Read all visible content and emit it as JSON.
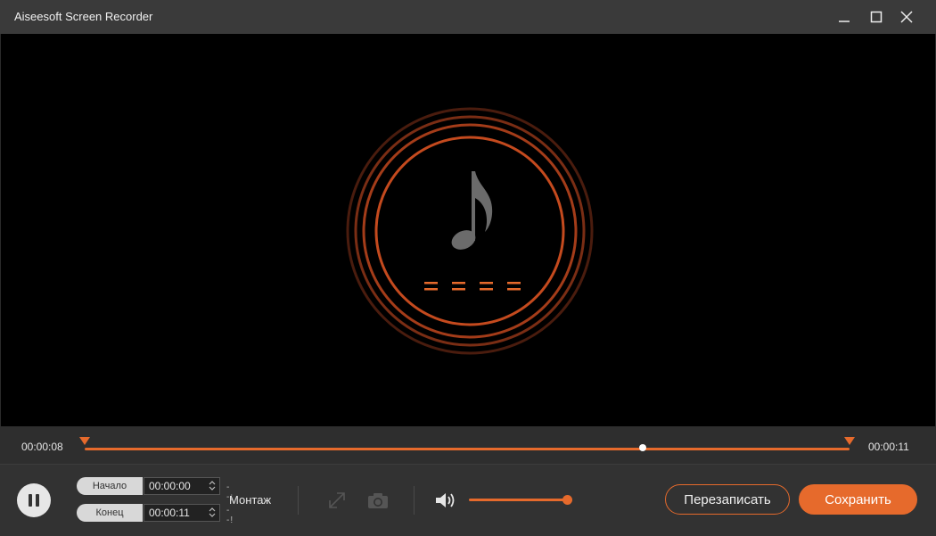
{
  "window": {
    "title": "Aiseesoft Screen Recorder"
  },
  "colors": {
    "accent": "#e66a2c",
    "background": "#2b2b2b",
    "preview": "#000000"
  },
  "preview": {
    "icon": "music-note-icon",
    "equalizer": "= = = ="
  },
  "timeline": {
    "current_time": "00:00:08",
    "total_time": "00:00:11",
    "progress_fraction": 0.73
  },
  "trim": {
    "start_label": "Начало",
    "start_value": "00:00:00",
    "end_label": "Конец",
    "end_value": "00:00:11",
    "start_bracket": "--;",
    "end_bracket": "--!"
  },
  "toolbar": {
    "montage_label": "Монтаж",
    "volume_level": 0.95,
    "rerecord_label": "Перезаписать",
    "save_label": "Сохранить"
  }
}
